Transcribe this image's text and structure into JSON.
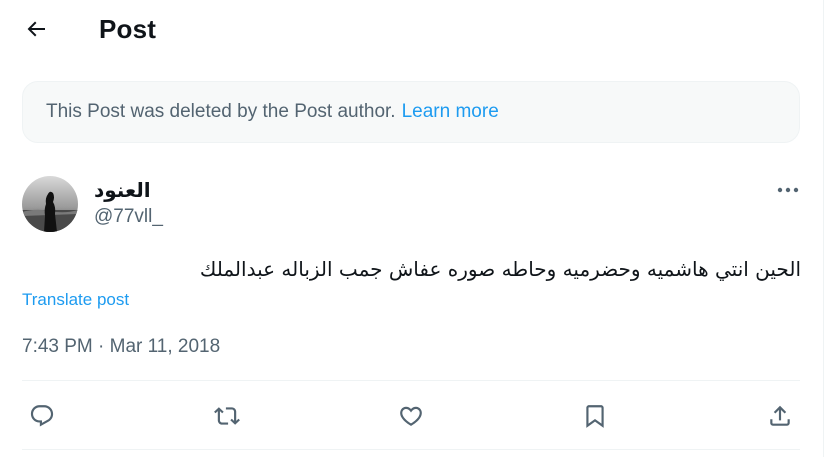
{
  "header": {
    "title": "Post"
  },
  "notice": {
    "text": "This Post was deleted by the Post author.",
    "link_label": "Learn more"
  },
  "post": {
    "author_name": "العنود",
    "author_handle": "@77vll_",
    "text": "الحين انتي هاشميه وحضرميه وحاطه صوره عفاش جمب الزباله عبدالملك",
    "translate_label": "Translate post",
    "timestamp": "7:43 PM · Mar 11, 2018"
  },
  "icons": {
    "back": "arrow-left-icon",
    "more": "more-horizontal-icon",
    "reply": "reply-icon",
    "repost": "repost-icon",
    "like": "heart-icon",
    "bookmark": "bookmark-icon",
    "share": "share-icon"
  },
  "colors": {
    "text": "#0f1419",
    "secondary": "#536471",
    "link": "#1d9bf0",
    "notice_bg": "#f7f9f9",
    "border": "#eff3f4"
  }
}
